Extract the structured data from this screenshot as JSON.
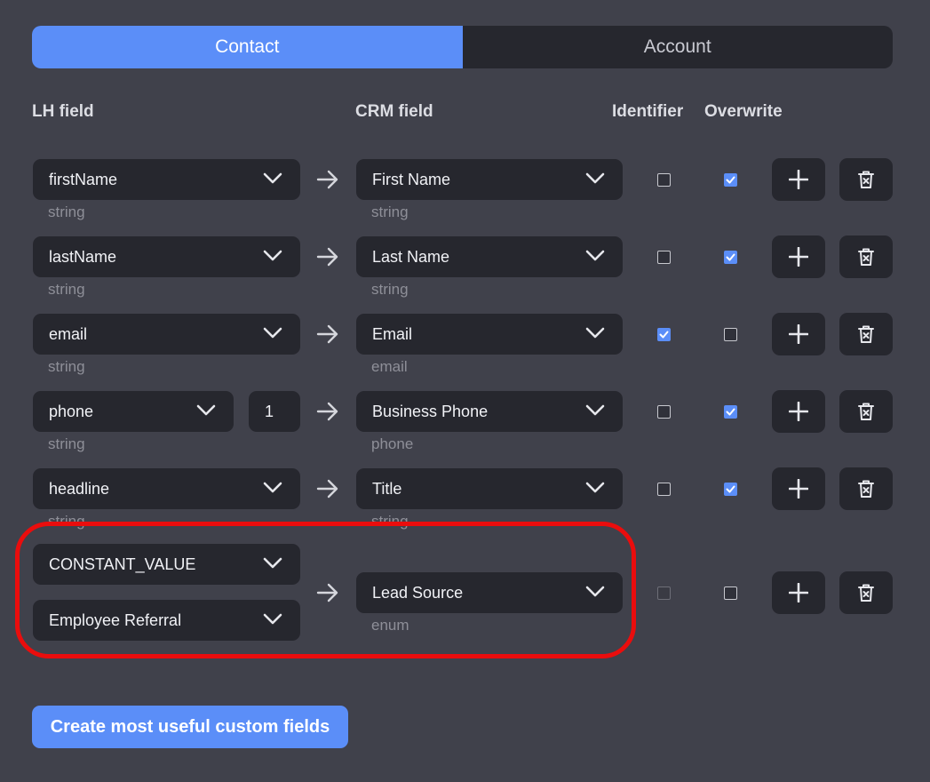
{
  "tabs": [
    {
      "label": "Contact",
      "active": true
    },
    {
      "label": "Account",
      "active": false
    }
  ],
  "headers": {
    "lh_field": "LH field",
    "crm_field": "CRM field",
    "identifier": "Identifier",
    "overwrite": "Overwrite"
  },
  "rows": [
    {
      "lh_field": "firstName",
      "lh_type": "string",
      "crm_field": "First Name",
      "crm_type": "string",
      "identifier": false,
      "overwrite": true
    },
    {
      "lh_field": "lastName",
      "lh_type": "string",
      "crm_field": "Last Name",
      "crm_type": "string",
      "identifier": false,
      "overwrite": true
    },
    {
      "lh_field": "email",
      "lh_type": "string",
      "crm_field": "Email",
      "crm_type": "email",
      "identifier": true,
      "overwrite": false
    },
    {
      "lh_field": "phone",
      "lh_index": "1",
      "lh_type": "string",
      "crm_field": "Business Phone",
      "crm_type": "phone",
      "identifier": false,
      "overwrite": true
    },
    {
      "lh_field": "headline",
      "lh_type": "string",
      "crm_field": "Title",
      "crm_type": "string",
      "identifier": false,
      "overwrite": true
    },
    {
      "lh_field": "CONSTANT_VALUE",
      "lh_value": "Employee Referral",
      "crm_field": "Lead Source",
      "crm_type": "enum",
      "identifier": false,
      "identifier_disabled": true,
      "overwrite": false
    }
  ],
  "icons": {
    "chevron": "chevron-down-icon",
    "arrow": "arrow-right-icon",
    "add": "plus-icon",
    "delete": "trash-icon",
    "check": "checkmark-icon"
  },
  "colors": {
    "accent": "#5b8ef8",
    "background": "#40414b",
    "control": "#26272e",
    "highlight": "#ea0d0d"
  },
  "cta": {
    "label": "Create most useful custom fields"
  }
}
